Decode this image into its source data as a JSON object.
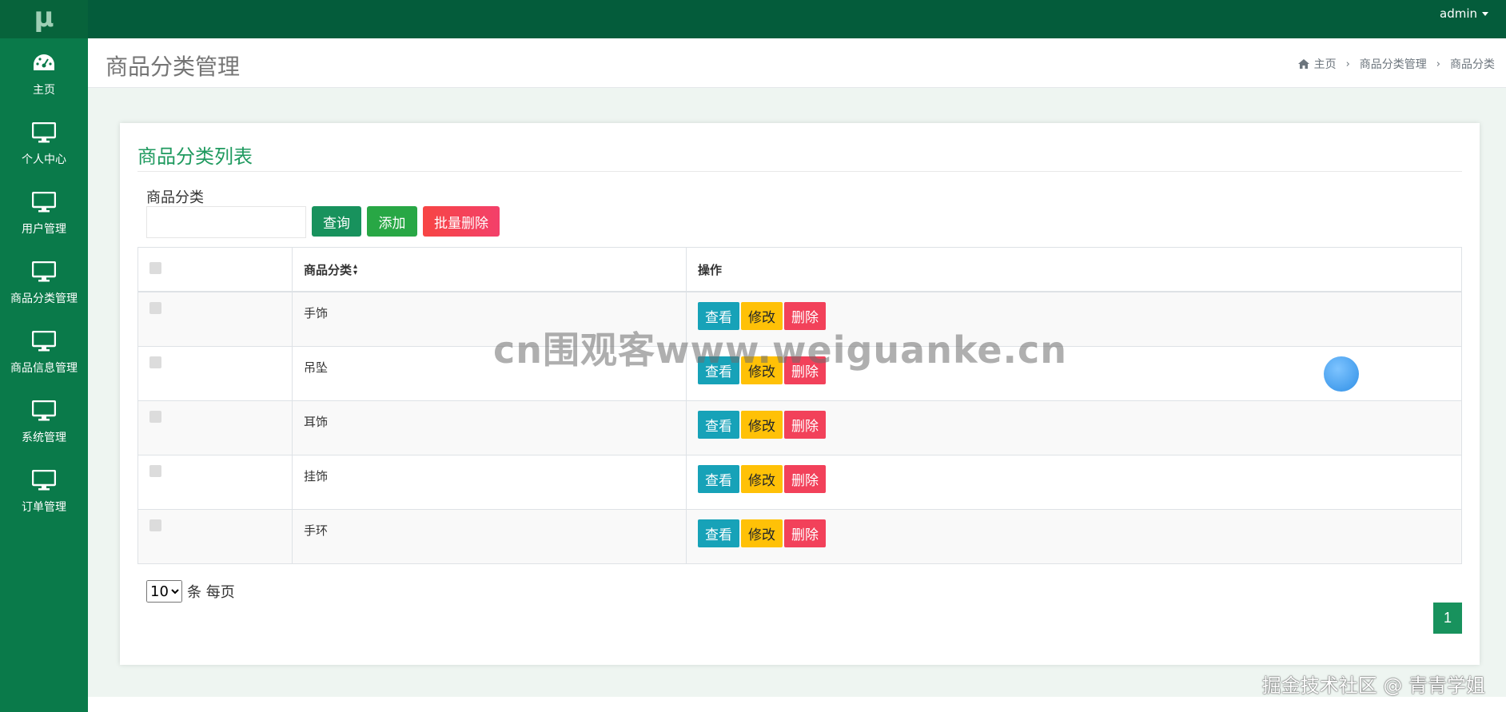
{
  "sidebar": {
    "logo": "μ",
    "items": [
      {
        "label": "主页",
        "icon": "dashboard-icon"
      },
      {
        "label": "个人中心",
        "icon": "monitor-icon"
      },
      {
        "label": "用户管理",
        "icon": "monitor-icon"
      },
      {
        "label": "商品分类管理",
        "icon": "monitor-icon"
      },
      {
        "label": "商品信息管理",
        "icon": "monitor-icon"
      },
      {
        "label": "系统管理",
        "icon": "monitor-icon"
      },
      {
        "label": "订单管理",
        "icon": "monitor-icon"
      }
    ]
  },
  "topbar": {
    "user": "admin"
  },
  "header": {
    "title": "商品分类管理",
    "breadcrumb": [
      "主页",
      "商品分类管理",
      "商品分类"
    ]
  },
  "card": {
    "title": "商品分类列表"
  },
  "search": {
    "label": "商品分类",
    "value": "",
    "query_label": "查询",
    "add_label": "添加",
    "batch_delete_label": "批量删除"
  },
  "table": {
    "headers": [
      "",
      "商品分类",
      "操作"
    ],
    "rows": [
      {
        "name": "手饰"
      },
      {
        "name": "吊坠"
      },
      {
        "name": "耳饰"
      },
      {
        "name": "挂饰"
      },
      {
        "name": "手环"
      }
    ],
    "actions": {
      "view": "查看",
      "edit": "修改",
      "delete": "删除"
    }
  },
  "pagination": {
    "page_size": "10",
    "page_size_suffix": "条 每页",
    "current_page": "1"
  },
  "overlays": {
    "watermark": "cn围观客www.weiguanke.cn",
    "credit": "掘金技术社区 @ 青青学姐"
  },
  "colors": {
    "sidebar": "#0a7a4a",
    "topbar": "#045c3b",
    "primary": "#18925d",
    "info": "#17a2b8",
    "warning": "#ffc107",
    "danger": "#f2415a"
  }
}
